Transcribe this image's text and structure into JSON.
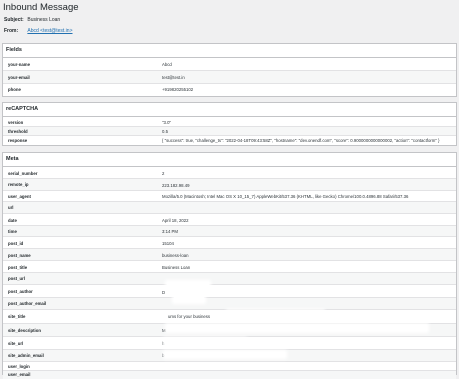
{
  "header": {
    "title": "Inbound Message"
  },
  "message": {
    "subject_label": "Subject:",
    "subject": "Business Loan",
    "from_label": "From:",
    "from": "Abcd <test@test.in>"
  },
  "fields": {
    "title": "Fields",
    "rows": [
      {
        "key": "your-name",
        "value": "Abcd"
      },
      {
        "key": "your-email",
        "value": "test@test.in"
      },
      {
        "key": "phone",
        "value": "+919820255102"
      }
    ]
  },
  "recaptcha": {
    "title": "reCAPTCHA",
    "rows": [
      {
        "key": "version",
        "value": "\"3.0\""
      },
      {
        "key": "threshold",
        "value": "0.5"
      },
      {
        "key": "response",
        "value": "{ \"success\": true, \"challenge_ts\": \"2022-04-18T09:43:58Z\", \"hostname\": \"dev.onendf.com\", \"score\": 0.9000000000000002, \"action\": \"contactform\" }"
      }
    ]
  },
  "meta": {
    "title": "Meta",
    "rows": [
      {
        "key": "serial_number",
        "value": "2"
      },
      {
        "key": "remote_ip",
        "value": "223.182.98.49"
      },
      {
        "key": "user_agent",
        "value": "Mozilla/5.0 (Macintosh; Intel Mac OS X 10_15_7) AppleWebKit/537.36 (KHTML, like Gecko) Chrome/100.0.4896.88 Safari/537.36"
      },
      {
        "key": "url",
        "value": ""
      },
      {
        "key": "date",
        "value": "April 18, 2022"
      },
      {
        "key": "time",
        "value": "3:14 PM"
      },
      {
        "key": "post_id",
        "value": "15104"
      },
      {
        "key": "post_name",
        "value": "business-loan"
      },
      {
        "key": "post_title",
        "value": "Business Loan"
      },
      {
        "key": "post_url",
        "value": ""
      },
      {
        "key": "post_author",
        "value": "D"
      },
      {
        "key": "post_author_email",
        "value": ""
      },
      {
        "key": "site_title",
        "value": "ums for your business"
      },
      {
        "key": "site_description",
        "value": "M"
      },
      {
        "key": "site_url",
        "value": "h"
      },
      {
        "key": "site_admin_email",
        "value": "b"
      },
      {
        "key": "user_login",
        "value": ""
      },
      {
        "key": "user_email",
        "value": ""
      }
    ]
  }
}
